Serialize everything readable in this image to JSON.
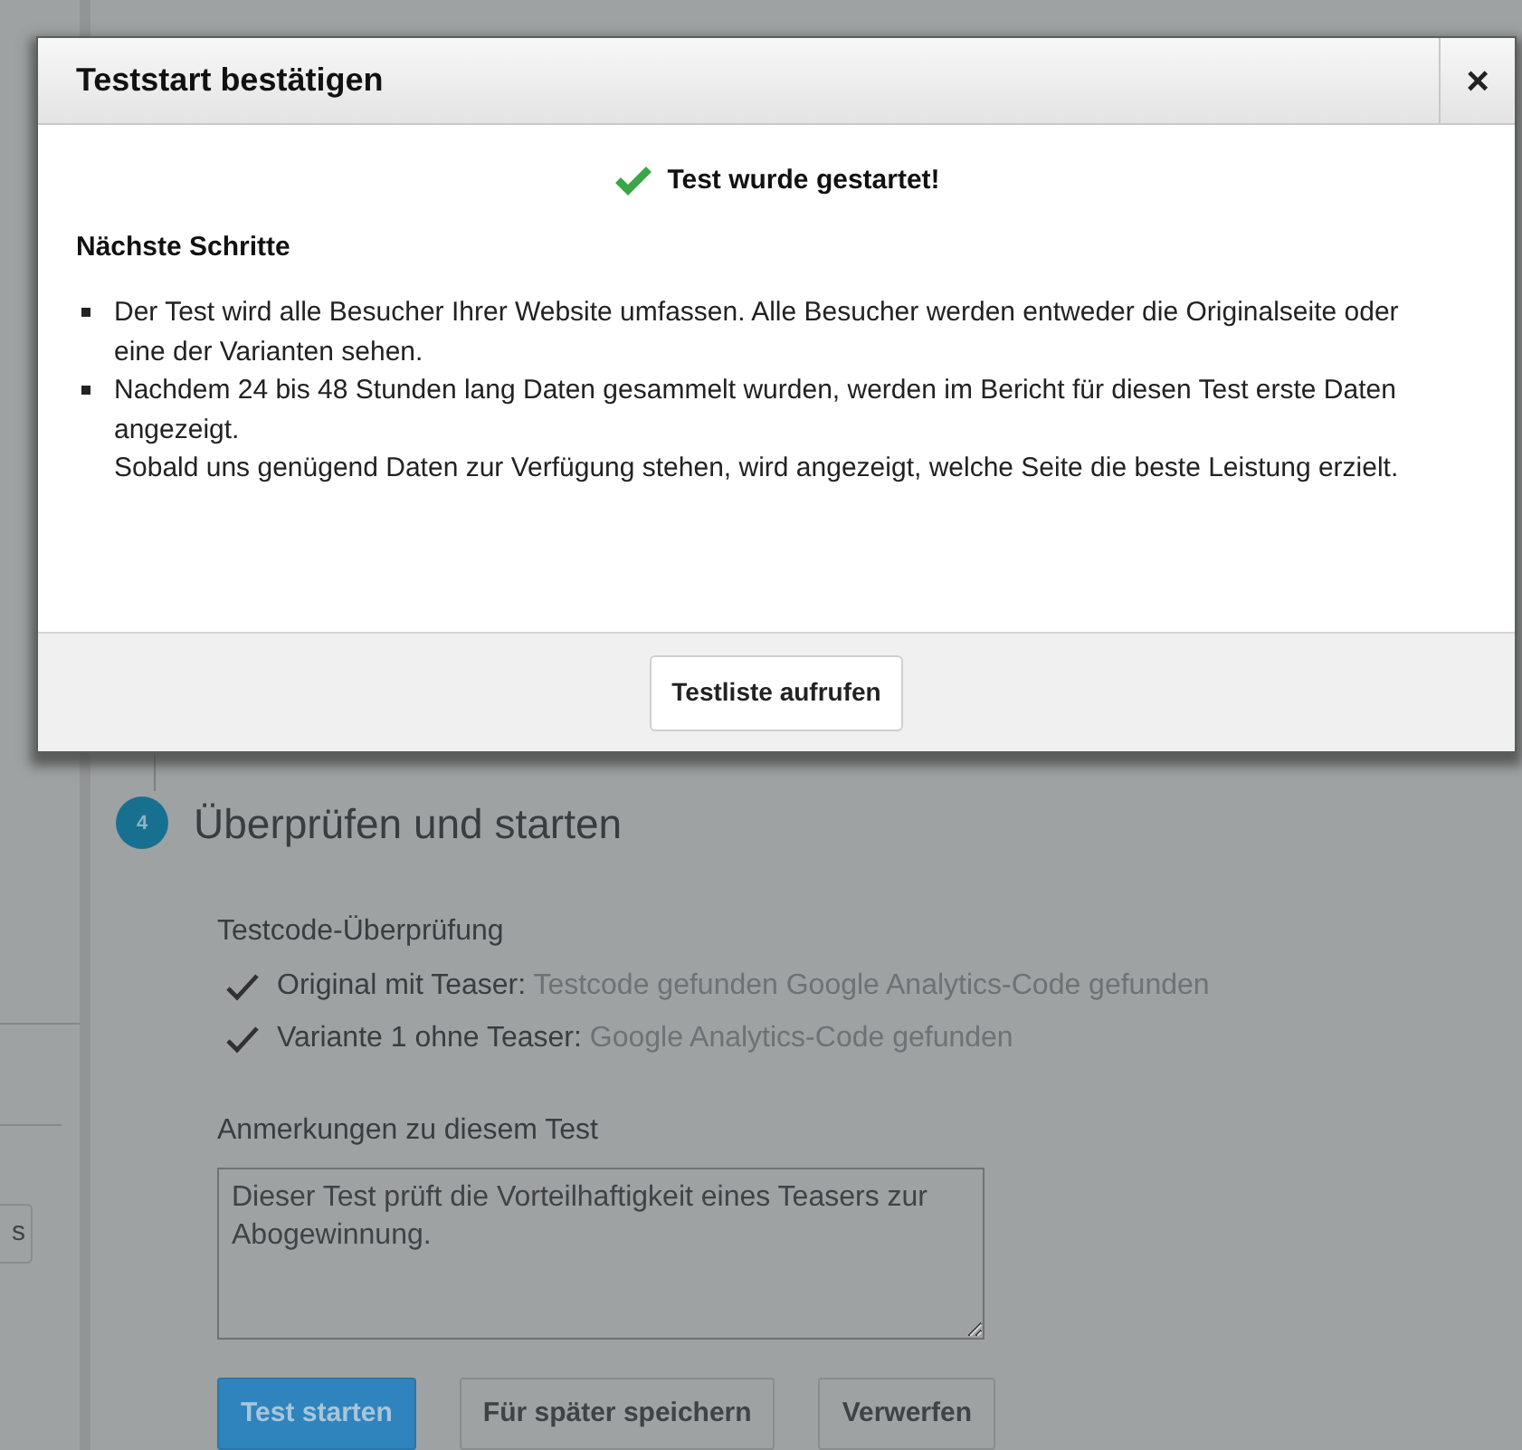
{
  "dialog": {
    "title": "Teststart bestätigen",
    "close": "×",
    "status": "Test wurde gestartet!",
    "section_title": "Nächste Schritte",
    "bullets": [
      {
        "text": "Der Test wird alle Besucher Ihrer Website umfassen. Alle Besucher werden entweder die Originalseite oder eine der Varianten sehen."
      },
      {
        "text": "Nachdem 24 bis 48 Stunden lang Daten gesammelt wurden, werden im Bericht für diesen Test erste Daten angezeigt.",
        "note": "Sobald uns genügend Daten zur Verfügung stehen, wird angezeigt, welche Seite die beste Leistung erzielt."
      }
    ],
    "footer_button": "Testliste aufrufen"
  },
  "sidebar": {
    "button": "s"
  },
  "step": {
    "number": "4",
    "title": "Überprüfen und starten"
  },
  "code_check": {
    "title": "Testcode-Überprüfung",
    "items": [
      {
        "label": "Original mit Teaser:",
        "status": "Testcode gefunden Google Analytics-Code gefunden",
        "checked": true
      },
      {
        "label": "Variante 1 ohne Teaser:",
        "status": "Google Analytics-Code gefunden",
        "checked": true
      }
    ]
  },
  "notes": {
    "label": "Anmerkungen zu diesem Test",
    "value": "Dieser Test prüft die Vorteilhaftigkeit eines Teasers zur Abogewinnung."
  },
  "buttons": [
    {
      "label": "Test starten",
      "kind": "primary"
    },
    {
      "label": "Für später speichern",
      "kind": "secondary"
    },
    {
      "label": "Verwerfen",
      "kind": "secondary"
    }
  ]
}
